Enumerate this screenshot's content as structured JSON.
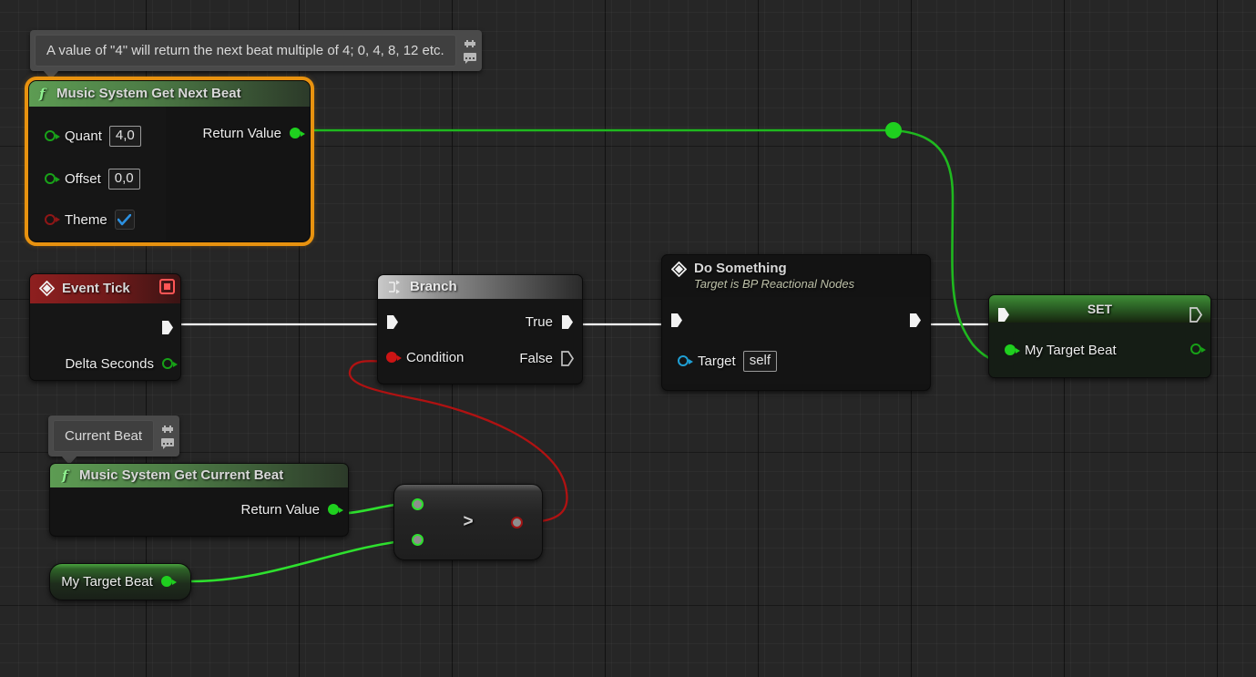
{
  "app": {
    "name": "Unreal Engine Blueprint Graph",
    "background_color": "#262626"
  },
  "comments": [
    {
      "id": "comment-next-beat",
      "text": "A value of \"4\" will return the next beat multiple of 4; 0, 4, 8, 12 etc.",
      "icons": [
        "pin-icon",
        "comment-bubble-icon"
      ]
    },
    {
      "id": "comment-current-beat",
      "text": "Current Beat",
      "icons": [
        "pin-icon",
        "comment-bubble-icon"
      ]
    }
  ],
  "nodes": {
    "get_next_beat": {
      "title": "Music System Get Next Beat",
      "icon": "function-f-icon",
      "selected": true,
      "inputs": [
        {
          "label": "Quant",
          "value": "4,0",
          "pin_type": "float",
          "pin_color": "#17a117"
        },
        {
          "label": "Offset",
          "value": "0,0",
          "pin_type": "float",
          "pin_color": "#17a117"
        },
        {
          "label": "Theme",
          "value": "true",
          "pin_type": "boolean",
          "pin_color": "#8e1414"
        }
      ],
      "outputs": [
        {
          "label": "Return Value",
          "pin_type": "float",
          "pin_color": "#1fd01f",
          "connected": true
        }
      ]
    },
    "event_tick": {
      "title": "Event Tick",
      "icon": "event-diamond-icon",
      "badge": "delta-stop-icon",
      "outputs_exec": [
        {
          "label": ""
        }
      ],
      "outputs": [
        {
          "label": "Delta Seconds",
          "pin_type": "float",
          "pin_color": "#17a117"
        }
      ]
    },
    "branch": {
      "title": "Branch",
      "icon": "branch-icon",
      "inputs_exec": [
        {
          "label": ""
        }
      ],
      "inputs": [
        {
          "label": "Condition",
          "pin_type": "boolean",
          "pin_color": "#cc1414",
          "connected": true
        }
      ],
      "outputs_exec": [
        {
          "label": "True",
          "connected": true
        },
        {
          "label": "False",
          "connected": false
        }
      ]
    },
    "do_something": {
      "title": "Do Something",
      "subtitle": "Target is BP Reactional Nodes",
      "icon": "event-diamond-icon",
      "inputs_exec": [
        {
          "label": ""
        }
      ],
      "outputs_exec": [
        {
          "label": ""
        }
      ],
      "inputs": [
        {
          "label": "Target",
          "value": "self",
          "pin_type": "object",
          "pin_color": "#1f9fd4"
        }
      ]
    },
    "set_node": {
      "title": "SET",
      "inputs_exec": [
        {
          "label": ""
        }
      ],
      "outputs_exec": [
        {
          "label": ""
        }
      ],
      "inputs": [
        {
          "label": "My Target Beat",
          "pin_type": "float",
          "pin_color": "#1fd01f",
          "connected": true
        }
      ],
      "outputs": [
        {
          "label": "",
          "pin_type": "float",
          "pin_color": "#17a117"
        }
      ]
    },
    "get_current_beat": {
      "title": "Music System Get Current Beat",
      "icon": "function-f-icon",
      "outputs": [
        {
          "label": "Return Value",
          "pin_type": "float",
          "pin_color": "#1fd01f",
          "connected": true
        }
      ]
    },
    "greater_than": {
      "operator": ">",
      "inputs": [
        {
          "label": "",
          "pin_type": "float",
          "pin_color": "#2ee02e",
          "connected": true
        },
        {
          "label": "",
          "pin_type": "float",
          "pin_color": "#2ee02e",
          "connected": true
        }
      ],
      "outputs": [
        {
          "label": "",
          "pin_type": "boolean",
          "pin_color": "#8e1414",
          "connected": true
        }
      ]
    },
    "my_target_beat_get": {
      "title": "My Target Beat",
      "outputs": [
        {
          "label": "",
          "pin_type": "float",
          "pin_color": "#1fd01f",
          "connected": true
        }
      ]
    }
  },
  "wires": [
    {
      "id": "wire-tick-to-branch",
      "type": "exec",
      "color": "#ffffff"
    },
    {
      "id": "wire-branch-true-to-do",
      "type": "exec",
      "color": "#ffffff"
    },
    {
      "id": "wire-do-to-set",
      "type": "exec",
      "color": "#ffffff"
    },
    {
      "id": "wire-nextbeat-to-set",
      "type": "float",
      "color": "#1fb81f"
    },
    {
      "id": "wire-currentbeat-to-gt",
      "type": "float",
      "color": "#2ee02e"
    },
    {
      "id": "wire-mytargetbeat-to-gt",
      "type": "float",
      "color": "#2ee02e"
    },
    {
      "id": "wire-gt-to-branch-condition",
      "type": "bool",
      "color": "#b01212"
    }
  ],
  "colors": {
    "selection": "#e8920f",
    "exec_wire": "#ffffff",
    "float_wire": "#1fb81f",
    "bool_wire": "#b01212",
    "function_header": "#5d9c53",
    "event_header": "#8e1f1f",
    "set_header": "#3e8a35",
    "target_pin": "#1f9fd4"
  }
}
